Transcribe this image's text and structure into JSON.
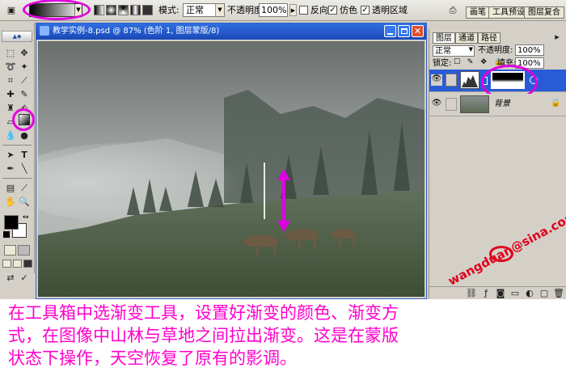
{
  "options_bar": {
    "mode_label": "模式:",
    "mode_value": "正常",
    "opacity_label": "不透明度:",
    "opacity_value": "100%",
    "reverse_label": "反向",
    "dither_label": "仿色",
    "transparency_label": "透明区域",
    "tabs": [
      "画笔",
      "工具预设",
      "图层复合"
    ]
  },
  "document": {
    "title": "教学实例-8.psd @ 87% (色阶 1, 图层蒙版/8)"
  },
  "layers_panel": {
    "tabs": [
      "图层",
      "通道",
      "路径"
    ],
    "blend_mode": "正常",
    "opacity_label": "不透明度:",
    "opacity_value": "100%",
    "lock_label": "锁定:",
    "fill_label": "填充:",
    "fill_value": "100%",
    "background_layer_name": "背景"
  },
  "watermark": "wangduan@sina.com",
  "caption": {
    "lines": [
      "在工具箱中选渐变工具，设置好渐变的颜色、渐变方",
      "式，在图像中山林与草地之间拉出渐变。这是在蒙版",
      "状态下操作，天空恢复了原有的影调。"
    ]
  },
  "colors": {
    "annotation": "#e000e0",
    "caption_text": "#ff00cc",
    "title_bar": "#1a48b8",
    "selected_layer": "#2a5bd6"
  }
}
